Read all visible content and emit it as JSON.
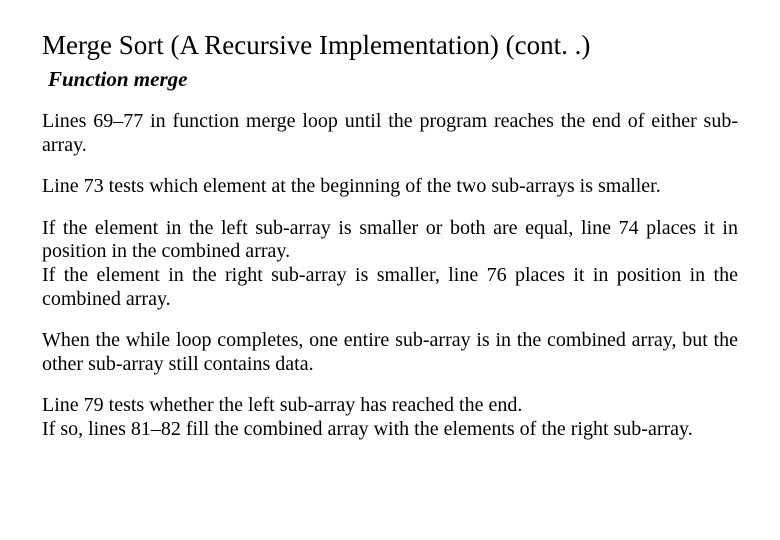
{
  "title": "Merge Sort (A Recursive Implementation) (cont. .)",
  "subtitle": "Function merge",
  "p1": "Lines 69–77 in function merge loop until the program reaches the end of either sub-array.",
  "p2": "Line 73 tests which element at the beginning of the two sub-arrays is smaller.",
  "p3a": "If the element in the left sub-array is smaller or both are equal, line 74 places it in position in the combined array.",
  "p3b": "If the element in the right sub-array is smaller, line 76 places it in position in the combined array.",
  "p4": "When the while loop completes, one entire sub-array is in the combined array, but the other sub-array still contains data.",
  "p5a": "Line 79 tests whether the left sub-array has reached the end.",
  "p5b": "If so, lines 81–82 fill the combined array with the elements of the right sub-array."
}
